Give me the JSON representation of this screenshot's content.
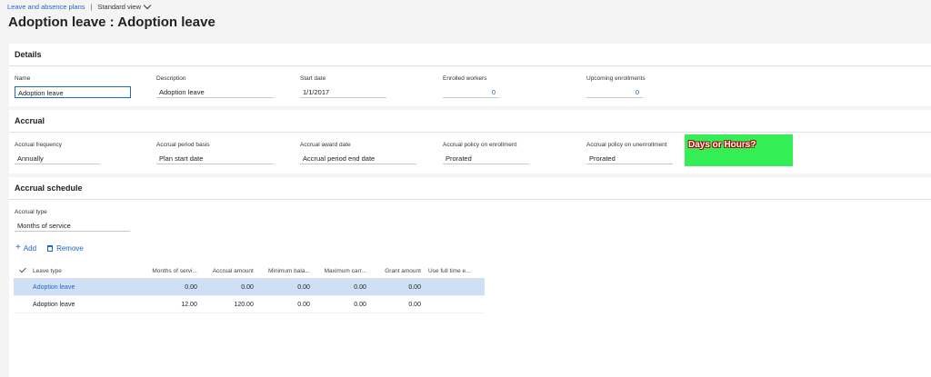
{
  "breadcrumb": {
    "link": "Leave and absence plans",
    "separator": "|",
    "view": "Standard view"
  },
  "title": "Adoption leave : Adoption leave",
  "details": {
    "header": "Details",
    "name": {
      "label": "Name",
      "value": "Adoption leave"
    },
    "description": {
      "label": "Description",
      "value": "Adoption leave"
    },
    "start_date": {
      "label": "Start date",
      "value": "1/1/2017"
    },
    "enrolled_workers": {
      "label": "Enrolled workers",
      "value": "0"
    },
    "upcoming_enrollments": {
      "label": "Upcoming enrollments",
      "value": "0"
    }
  },
  "accrual": {
    "header": "Accrual",
    "frequency": {
      "label": "Accrual frequency",
      "value": "Annually"
    },
    "period_basis": {
      "label": "Accrual period basis",
      "value": "Plan start date"
    },
    "award_date": {
      "label": "Accrual award date",
      "value": "Accrual period end date"
    },
    "policy_enrollment": {
      "label": "Accrual policy on enrollment",
      "value": "Prorated"
    },
    "policy_unenrollment": {
      "label": "Accrual policy on unenrollment",
      "value": "Prorated"
    }
  },
  "callout": "Days or Hours?",
  "schedule": {
    "header": "Accrual schedule",
    "accrual_type": {
      "label": "Accrual type",
      "value": "Months of service"
    },
    "toolbar": {
      "add": "Add",
      "remove": "Remove"
    },
    "columns": [
      "Leave type",
      "Months of servi...",
      "Accrual amount",
      "Minimum bala...",
      "Maximum carr...",
      "Grant amount",
      "Use full time e..."
    ],
    "rows": [
      [
        "Adoption leave",
        "0.00",
        "0.00",
        "0.00",
        "0.00",
        "0.00",
        ""
      ],
      [
        "Adoption leave",
        "12.00",
        "120.00",
        "0.00",
        "0.00",
        "0.00",
        ""
      ]
    ]
  },
  "colors": {
    "accent": "#2266cc",
    "callout_bg": "#33ee55",
    "selected_row": "#cfe0f6"
  }
}
